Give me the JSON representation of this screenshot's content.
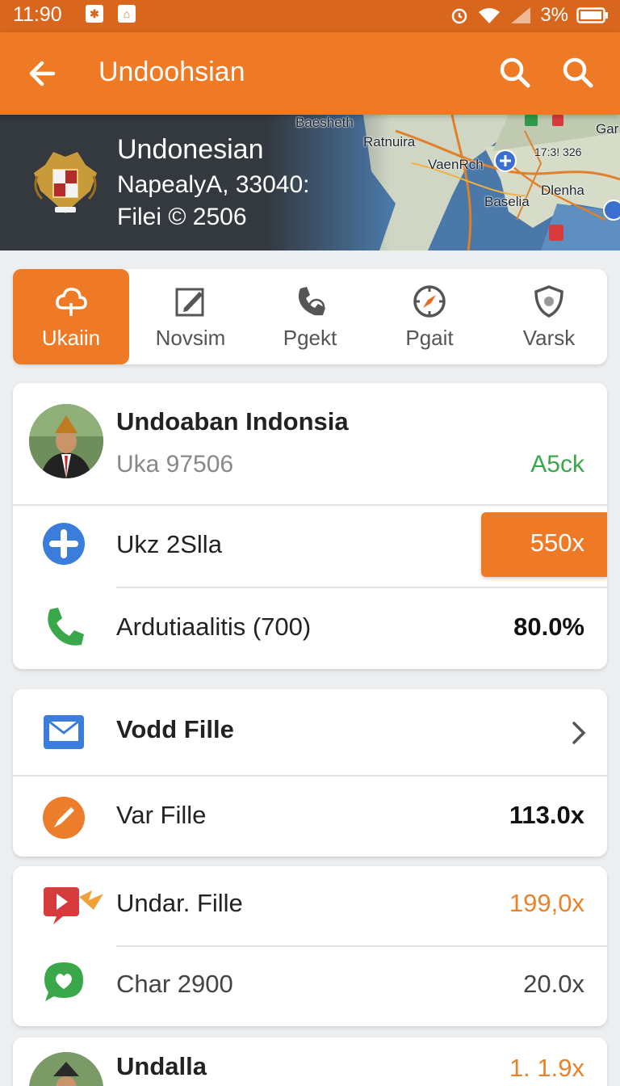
{
  "status_bar": {
    "time": "11:90",
    "battery": "3%"
  },
  "app_bar": {
    "title": "Undoohsian"
  },
  "banner": {
    "title": "Undonesian",
    "line1": "NapealyA, 33040:",
    "line2": "Filei © 2506",
    "map_labels": [
      "Baesheth",
      "Ratnuira",
      "VaenRch",
      "Baselia",
      "Dlenha",
      "Gar",
      "17:3! 326"
    ]
  },
  "tabs": [
    {
      "label": "Ukaiin",
      "icon": "cloud-icon",
      "active": true
    },
    {
      "label": "Novsim",
      "icon": "edit-icon",
      "active": false
    },
    {
      "label": "Pgekt",
      "icon": "phone-icon",
      "active": false
    },
    {
      "label": "Pgait",
      "icon": "compass-icon",
      "active": false
    },
    {
      "label": "Varsk",
      "icon": "shield-icon",
      "active": false
    }
  ],
  "profile_card": {
    "name": "Undoaban Indonsia",
    "subtitle": "Uka 97506",
    "status": "A5ck",
    "rows": [
      {
        "label": "Ukz 2Slla",
        "value": "550x",
        "icon": "plus-icon"
      },
      {
        "label": "Ardutiaalitis (700)",
        "value": "80.0%",
        "icon": "phone-icon"
      }
    ]
  },
  "file_card_1": {
    "rows": [
      {
        "label": "Vodd Fille",
        "icon": "mail-icon"
      },
      {
        "label": "Var Fille",
        "value": "113.0x",
        "icon": "pencil-icon"
      }
    ]
  },
  "file_card_2": {
    "rows": [
      {
        "label": "Undar. Fille",
        "value": "199,0x",
        "icon": "video-icon"
      },
      {
        "label": "Char 2900",
        "value": "20.0x",
        "icon": "chat-icon"
      }
    ]
  },
  "bottom_card": {
    "label": "Undalla",
    "value": "1. 1.9x"
  },
  "colors": {
    "accent": "#ef7a26",
    "status_bar": "#d8661c",
    "green": "#3aa84a",
    "orange_value": "#e9832a"
  }
}
